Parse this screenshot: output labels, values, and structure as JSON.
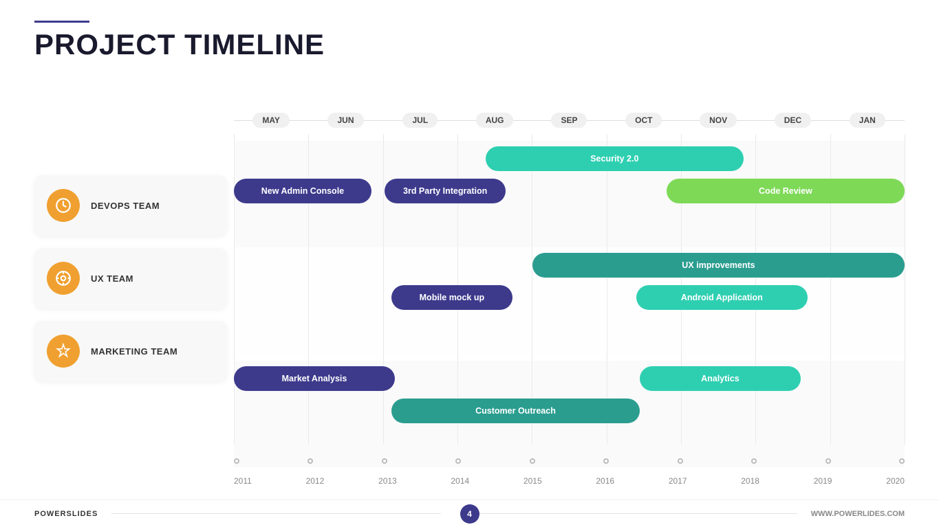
{
  "header": {
    "line_color": "#3d3a8c",
    "title": "PROJECT TIMELINE"
  },
  "footer": {
    "brand_left": "POWERSLIDES",
    "page_number": "4",
    "brand_right": "WWW.POWERLIDES.COM"
  },
  "months": [
    "MAY",
    "JUN",
    "JUL",
    "AUG",
    "SEP",
    "OCT",
    "NOV",
    "DEC",
    "JAN"
  ],
  "years": [
    "2011",
    "2012",
    "2013",
    "2014",
    "2015",
    "2016",
    "2017",
    "2018",
    "2019",
    "2020"
  ],
  "teams": [
    {
      "name": "DEVOPS TEAM",
      "icon": "clock"
    },
    {
      "name": "UX TEAM",
      "icon": "compass"
    },
    {
      "name": "MARKETING TEAM",
      "icon": "hourglass"
    }
  ],
  "bars": [
    {
      "label": "Security 2.0",
      "color": "#2ecfb1",
      "row": 0,
      "subrow": 0,
      "left_pct": 37.5,
      "width_pct": 38.5
    },
    {
      "label": "New Admin Console",
      "color": "#3d3a8c",
      "row": 0,
      "subrow": 1,
      "left_pct": 0,
      "width_pct": 20.5
    },
    {
      "label": "3rd Party Integration",
      "color": "#3d3a8c",
      "row": 0,
      "subrow": 1,
      "left_pct": 22.5,
      "width_pct": 18.0
    },
    {
      "label": "Code Review",
      "color": "#7ed957",
      "row": 0,
      "subrow": 1,
      "left_pct": 64.5,
      "width_pct": 35.5
    },
    {
      "label": "UX improvements",
      "color": "#2a9d8f",
      "row": 1,
      "subrow": 0,
      "left_pct": 44.5,
      "width_pct": 55.5
    },
    {
      "label": "Mobile mock up",
      "color": "#3d3a8c",
      "row": 1,
      "subrow": 1,
      "left_pct": 23.5,
      "width_pct": 18.0
    },
    {
      "label": "Android Application",
      "color": "#2ecfb1",
      "row": 1,
      "subrow": 1,
      "left_pct": 60.0,
      "width_pct": 25.5
    },
    {
      "label": "Market Analysis",
      "color": "#3d3a8c",
      "row": 2,
      "subrow": 0,
      "left_pct": 0,
      "width_pct": 24.0
    },
    {
      "label": "Analytics",
      "color": "#2ecfb1",
      "row": 2,
      "subrow": 0,
      "left_pct": 60.5,
      "width_pct": 24.0
    },
    {
      "label": "Customer Outreach",
      "color": "#2a9d8f",
      "row": 2,
      "subrow": 1,
      "left_pct": 23.5,
      "width_pct": 37.0
    }
  ]
}
